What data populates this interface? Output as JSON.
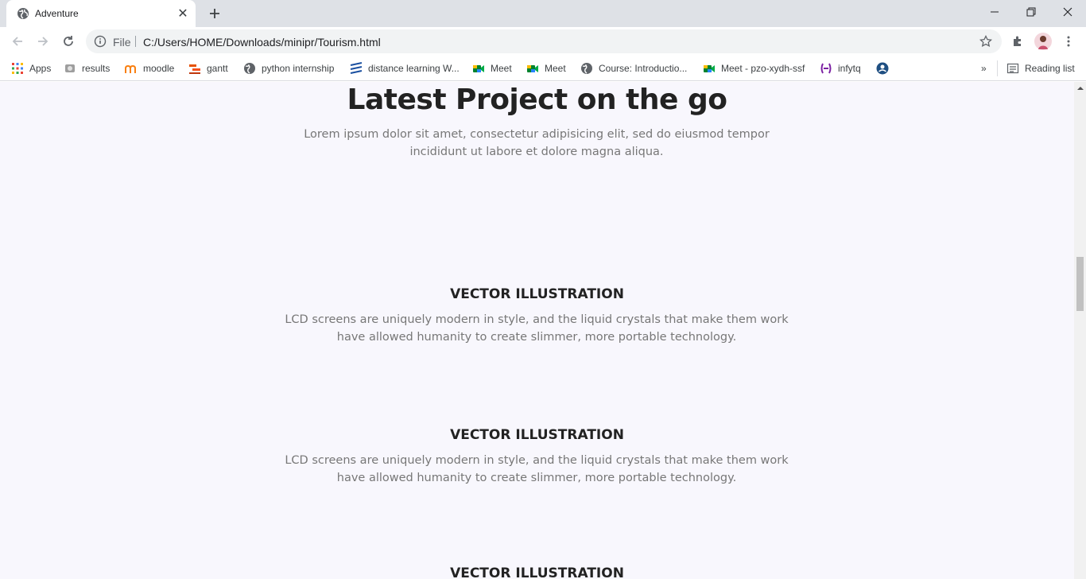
{
  "browser": {
    "tab": {
      "title": "Adventure",
      "favicon": "globe-icon"
    },
    "address": {
      "scheme_label": "File",
      "url": "C:/Users/HOME/Downloads/minipr/Tourism.html"
    },
    "bookmarks": [
      {
        "label": "Apps",
        "icon": "apps-grid-icon"
      },
      {
        "label": "results",
        "icon": "results-icon"
      },
      {
        "label": "moodle",
        "icon": "moodle-icon"
      },
      {
        "label": "gantt",
        "icon": "gantt-icon"
      },
      {
        "label": "python internship",
        "icon": "globe-icon"
      },
      {
        "label": "distance learning W...",
        "icon": "stripes-icon"
      },
      {
        "label": "Meet",
        "icon": "meet-icon"
      },
      {
        "label": "Meet",
        "icon": "meet-icon"
      },
      {
        "label": "Course: Introductio...",
        "icon": "globe-icon"
      },
      {
        "label": "Meet - pzo-xydh-ssf",
        "icon": "meet-icon"
      },
      {
        "label": "infytq",
        "icon": "infytq-icon"
      },
      {
        "label": "",
        "icon": "blue-circle-icon"
      }
    ],
    "reading_list": "Reading list",
    "overflow": "»"
  },
  "page": {
    "heading": "Latest Project on the go",
    "intro": "Lorem ipsum dolor sit amet, consectetur adipisicing elit, sed do eiusmod tempor incididunt ut labore et dolore magna aliqua.",
    "items": [
      {
        "title": "VECTOR ILLUSTRATION",
        "text": "LCD screens are uniquely modern in style, and the liquid crystals that make them work have allowed humanity to create slimmer, more portable technology."
      },
      {
        "title": "VECTOR ILLUSTRATION",
        "text": "LCD screens are uniquely modern in style, and the liquid crystals that make them work have allowed humanity to create slimmer, more portable technology."
      },
      {
        "title": "VECTOR ILLUSTRATION",
        "text": ""
      }
    ]
  },
  "colors": {
    "page_bg": "#f8f7fd",
    "heading": "#222222",
    "body_text": "#777777",
    "tabstrip": "#dee1e6"
  }
}
